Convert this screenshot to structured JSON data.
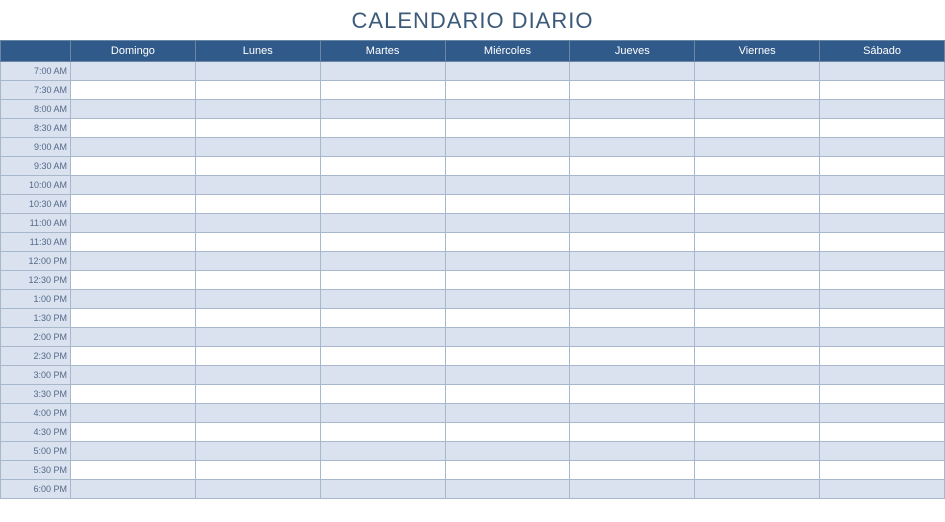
{
  "title": "CALENDARIO DIARIO",
  "days": [
    "Domingo",
    "Lunes",
    "Martes",
    "Miércoles",
    "Jueves",
    "Viernes",
    "Sábado"
  ],
  "times": [
    "7:00 AM",
    "7:30 AM",
    "8:00 AM",
    "8:30 AM",
    "9:00 AM",
    "9:30 AM",
    "10:00 AM",
    "10:30 AM",
    "11:00 AM",
    "11:30 AM",
    "12:00 PM",
    "12:30 PM",
    "1:00 PM",
    "1:30 PM",
    "2:00 PM",
    "2:30 PM",
    "3:00 PM",
    "3:30 PM",
    "4:00 PM",
    "4:30 PM",
    "5:00 PM",
    "5:30 PM",
    "6:00 PM"
  ],
  "colors": {
    "header_bg": "#305a8a",
    "alt_row_bg": "#d9e2ee",
    "title_color": "#3b5a7a"
  }
}
